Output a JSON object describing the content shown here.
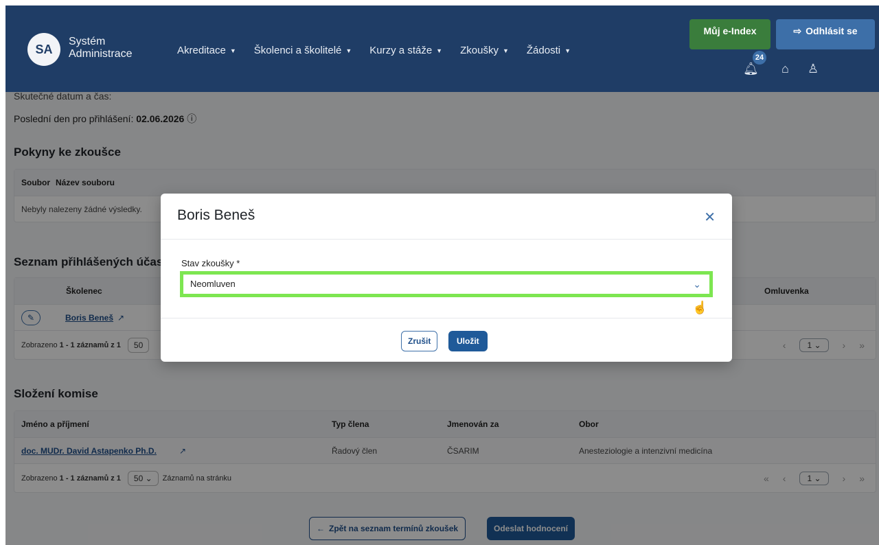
{
  "header": {
    "logo_badge": "SA",
    "logo_line1": "Systém",
    "logo_line2": "Administrace",
    "nav": [
      "Akreditace",
      "Školenci a školitelé",
      "Kurzy a stáže",
      "Zkoušky",
      "Žádosti"
    ],
    "my_index": "Můj e-Index",
    "logout": "Odhlásit se",
    "notif_count": "24"
  },
  "page": {
    "actual_datetime": "Skutečné datum a čas:",
    "deadline_label": "Poslední den pro přihlášení:",
    "deadline_value": "02.06.2026",
    "instructions_title": "Pokyny ke zkoušce",
    "files_headers": [
      "Soubor",
      "Název souboru"
    ],
    "files_empty": "Nebyly nalezeny žádné výsledky.",
    "participants_title": "Seznam přihlášených účas",
    "participants_header": "Školenec",
    "participants_header_right": "Omluvenka",
    "participant_name": "Boris Beneš",
    "pager_prefix": "Zobrazeno",
    "pager_range": "1 - 1 záznamů z 1",
    "pager_size": "50",
    "pager_page": "1",
    "committee_title": "Složení komise",
    "committee_headers": [
      "Jméno a příjmení",
      "Typ člena",
      "Jmenován za",
      "Obor"
    ],
    "committee_row": [
      "doc. MUDr. David Astapenko Ph.D.",
      "Řadový člen",
      "ČSARIM",
      "Anesteziologie a intenzivní medicína"
    ],
    "per_page_label": "Záznamů na stránku",
    "back_button": "Zpět na seznam termínů zkoušek",
    "send_button": "Odeslat hodnocení"
  },
  "modal": {
    "title": "Boris Beneš",
    "field_label": "Stav zkoušky *",
    "field_value": "Neomluven",
    "cancel": "Zrušit",
    "save": "Uložit"
  }
}
